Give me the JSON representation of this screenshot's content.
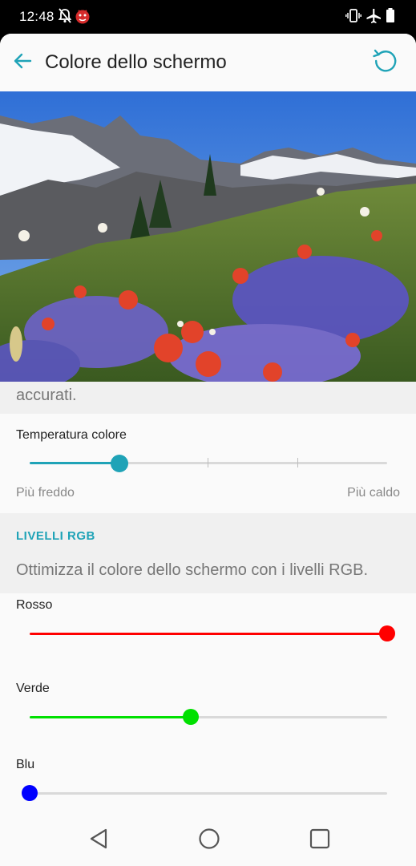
{
  "status_bar": {
    "time": "12:48",
    "icons": [
      "notifications-off-icon",
      "app-notification-icon",
      "vibrate-icon",
      "airplane-mode-icon",
      "battery-icon"
    ]
  },
  "toolbar": {
    "title": "Colore dello schermo",
    "back_icon": "arrow-left-icon",
    "reset_icon": "reset-icon",
    "accent_color": "#1fa3b7"
  },
  "preview": {
    "image": "mountain-wildflowers-photo"
  },
  "description_tail": "accurati.",
  "temperature": {
    "label": "Temperatura colore",
    "min_label": "Più freddo",
    "max_label": "Più caldo",
    "value_fraction": 0.25,
    "color": "#1fa3b7"
  },
  "rgb": {
    "header": "LIVELLI RGB",
    "description": "Ottimizza il colore dello schermo con i livelli RGB.",
    "channels": [
      {
        "name": "Rosso",
        "value_fraction": 1.0,
        "color": "#ff0000"
      },
      {
        "name": "Verde",
        "value_fraction": 0.45,
        "color": "#00e000"
      },
      {
        "name": "Blu",
        "value_fraction": 0.0,
        "color": "#0000ff"
      }
    ]
  },
  "navigation": {
    "back_icon": "nav-back-icon",
    "home_icon": "nav-home-icon",
    "recents_icon": "nav-recents-icon"
  }
}
